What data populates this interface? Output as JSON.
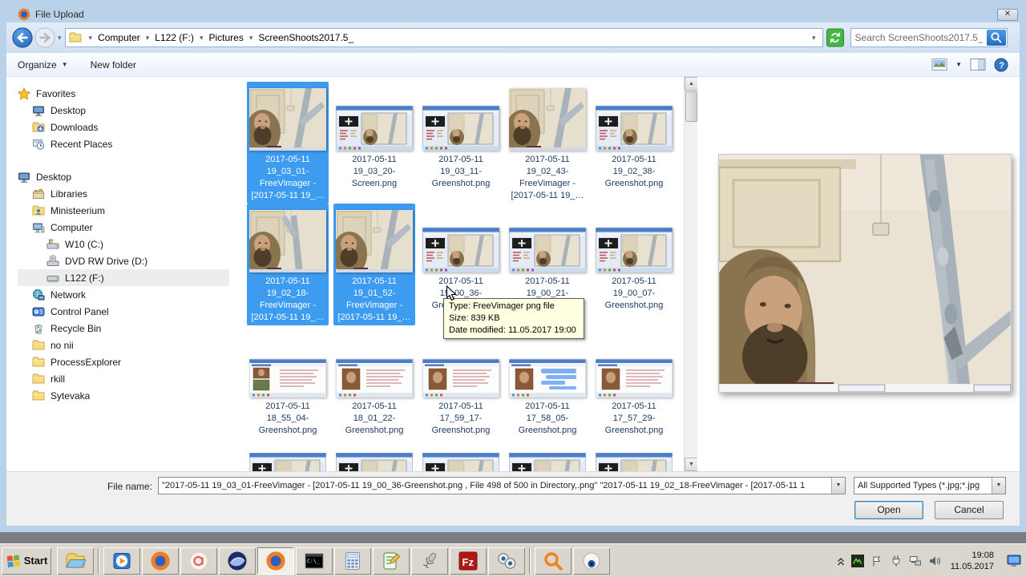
{
  "window": {
    "title": "File Upload",
    "close_label": "✕",
    "app_icon": "firefox-icon"
  },
  "navigation": {
    "breadcrumb_items": [
      "Computer",
      "L122 (F:)",
      "Pictures",
      "ScreenShoots2017.5_"
    ],
    "search_value": "Search ScreenShoots2017.5_"
  },
  "toolbar": {
    "organize_label": "Organize",
    "new_folder_label": "New folder"
  },
  "sidebar": {
    "items": [
      {
        "label": "Favorites",
        "icon": "star",
        "indent": 0
      },
      {
        "label": "Desktop",
        "icon": "monitor",
        "indent": 1
      },
      {
        "label": "Downloads",
        "icon": "folder-down",
        "indent": 1
      },
      {
        "label": "Recent Places",
        "icon": "recent",
        "indent": 1
      },
      {
        "label": "Desktop",
        "icon": "monitor",
        "indent": 0,
        "gap_before": true
      },
      {
        "label": "Libraries",
        "icon": "libraries",
        "indent": 1
      },
      {
        "label": "Ministeerium",
        "icon": "user-folder",
        "indent": 1
      },
      {
        "label": "Computer",
        "icon": "computer",
        "indent": 1
      },
      {
        "label": "W10 (C:)",
        "icon": "drive-win",
        "indent": 2
      },
      {
        "label": "DVD RW Drive (D:)",
        "icon": "drive-dvd",
        "indent": 2
      },
      {
        "label": "L122 (F:)",
        "icon": "drive",
        "indent": 2,
        "highlighted": true
      },
      {
        "label": "Network",
        "icon": "network",
        "indent": 1
      },
      {
        "label": "Control Panel",
        "icon": "control-panel",
        "indent": 1
      },
      {
        "label": "Recycle Bin",
        "icon": "recycle-bin",
        "indent": 1
      },
      {
        "label": "no nii",
        "icon": "folder",
        "indent": 1
      },
      {
        "label": "ProcessExplorer",
        "icon": "folder",
        "indent": 1
      },
      {
        "label": "rkill",
        "icon": "folder",
        "indent": 1
      },
      {
        "label": "Sytevaka",
        "icon": "folder",
        "indent": 1
      }
    ]
  },
  "file_list": {
    "rows": [
      [
        {
          "label": "2017-05-11 19_03_01-FreeVimager - [2017-05-11 19_…",
          "kind": "webcam-photo",
          "selected": true
        },
        {
          "label": "2017-05-11 19_03_20-Screen.png",
          "kind": "app-screenshot"
        },
        {
          "label": "2017-05-11 19_03_11-Greenshot.png",
          "kind": "app-screenshot"
        },
        {
          "label": "2017-05-11 19_02_43-FreeVimager - [2017-05-11 19_…",
          "kind": "webcam-photo"
        },
        {
          "label": "2017-05-11 19_02_38-Greenshot.png",
          "kind": "app-screenshot"
        }
      ],
      [
        {
          "label": "2017-05-11 19_02_18-FreeVimager - [2017-05-11 19_…",
          "kind": "webcam-photo",
          "variant": "fork",
          "selected": true
        },
        {
          "label": "2017-05-11 19_01_52-FreeVimager - [2017-05-11 19_…",
          "kind": "webcam-photo",
          "selected": true
        },
        {
          "label": "2017-05-11 19_00_36-Greenshot.png",
          "kind": "app-screenshot",
          "hovered": true
        },
        {
          "label": "2017-05-11 19_00_21-Greenshot.png",
          "kind": "app-screenshot"
        },
        {
          "label": "2017-05-11 19_00_07-Greenshot.png",
          "kind": "app-screenshot"
        }
      ],
      [
        {
          "label": "2017-05-11 18_55_04-Greenshot.png",
          "kind": "fb-screenshot",
          "variant": "two"
        },
        {
          "label": "2017-05-11 18_01_22-Greenshot.png",
          "kind": "fb-screenshot"
        },
        {
          "label": "2017-05-11 17_59_17-Greenshot.png",
          "kind": "fb-screenshot"
        },
        {
          "label": "2017-05-11 17_58_05-Greenshot.png",
          "kind": "fb-screenshot",
          "variant": "chat"
        },
        {
          "label": "2017-05-11 17_57_29-Greenshot.png",
          "kind": "fb-screenshot"
        }
      ]
    ],
    "partial_row_count": 5,
    "tooltip": {
      "lines": [
        "Type: FreeVimager png file",
        "Size: 839 KB",
        "Date modified: 11.05.2017 19:00"
      ]
    }
  },
  "footer": {
    "file_name_label": "File name:",
    "file_name_value": "\"2017-05-11 19_03_01-FreeVimager - [2017-05-11 19_00_36-Greenshot.png , File 498 of 500 in Directory,.png\" \"2017-05-11 19_02_18-FreeVimager - [2017-05-11 1",
    "file_type_value": "All Supported Types (*.jpg;*.jpg",
    "open_label": "Open",
    "cancel_label": "Cancel"
  },
  "taskbar": {
    "start_label": "Start",
    "buttons": [
      {
        "icon": "explorer",
        "sep_after": true
      },
      {
        "icon": "wmp"
      },
      {
        "icon": "firefox"
      },
      {
        "icon": "app-a"
      },
      {
        "icon": "seamonkey"
      },
      {
        "icon": "firefox",
        "active": true
      },
      {
        "icon": "cmd"
      },
      {
        "icon": "calculator"
      },
      {
        "icon": "notepadpp"
      },
      {
        "icon": "microphone"
      },
      {
        "icon": "filezilla"
      },
      {
        "icon": "binoculars",
        "sep_after": true
      },
      {
        "icon": "magnifier"
      },
      {
        "icon": "eyeball"
      }
    ],
    "tray_icons": [
      "collapse-chevron",
      "console-activity",
      "flag",
      "power-plug",
      "network",
      "volume"
    ],
    "clock": {
      "time": "19:08",
      "date": "11.05.2017"
    }
  },
  "colors": {
    "selection": "#3d9bf0",
    "titlebar": "#b9d1e9",
    "tooltip_bg": "#ffffe1",
    "taskbar": "#dad6cd"
  }
}
